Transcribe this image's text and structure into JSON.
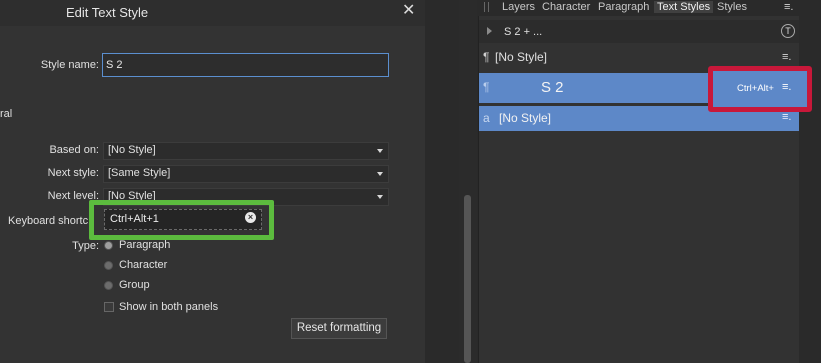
{
  "dialog": {
    "title": "Edit Text Style",
    "close_glyph": "✕",
    "style_name_label": "Style name:",
    "style_name_value": "S 2",
    "section_label": "ral",
    "based_on_label": "Based on:",
    "based_on_value": "[No Style]",
    "next_style_label": "Next style:",
    "next_style_value": "[Same Style]",
    "next_level_label": "Next level:",
    "next_level_value": "[No Style]",
    "shortcut_label": "Keyboard shortc",
    "shortcut_value": "Ctrl+Alt+1",
    "type_label": "Type:",
    "type_option_paragraph": "Paragraph",
    "type_option_character": "Character",
    "type_option_group": "Group",
    "show_both_label": "Show in both panels",
    "reset_button": "Reset formatting"
  },
  "panel": {
    "tabs": [
      "Layers",
      "Character",
      "Paragraph",
      "Text Styles",
      "Styles"
    ],
    "active_tab": "Text Styles",
    "menu_glyph": "≡.",
    "breadcrumb": "S 2 + ...",
    "t_icon": "T",
    "styles": [
      {
        "glyph": "¶",
        "name": "[No Style]"
      },
      {
        "glyph": "¶",
        "name": "S 2",
        "shortcut": "Ctrl+Alt+"
      },
      {
        "glyph": "a",
        "name": "[No Style]"
      }
    ]
  },
  "colors": {
    "accent_selection": "#5d88c8",
    "highlight_green": "#5cbb3e",
    "highlight_red": "#c8183a"
  }
}
